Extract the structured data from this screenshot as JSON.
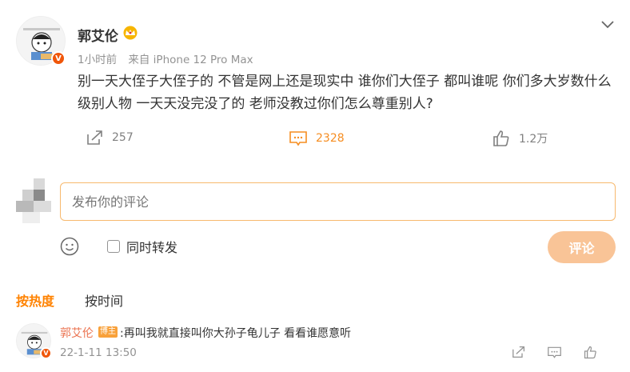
{
  "post": {
    "author": "郭艾伦",
    "time": "1小时前",
    "source": "来自 iPhone 12 Pro Max",
    "text": "别一天大侄子大侄子的 不管是网上还是现实中 谁你们大侄子 都叫谁呢 你们多大岁数什么级别人物 一天天没完没了的 老师没教过你们怎么尊重别人?",
    "shares": "257",
    "comments": "2328",
    "likes": "1.2万"
  },
  "composer": {
    "placeholder": "发布你的评论",
    "repost_label": "同时转发",
    "submit_label": "评论"
  },
  "sort": {
    "hot": "按热度",
    "time": "按时间"
  },
  "first_comment": {
    "author": "郭艾伦",
    "tag": "博主",
    "text": ":再叫我就直接叫你大孙子龟儿子 看看谁愿意听",
    "time": "22-1-11 13:50"
  },
  "colors": {
    "accent": "#ff8200",
    "verified_badge": "#f0560a",
    "comment_count": "#f68d21",
    "author_link": "#eb7350",
    "submit_disabled": "#f9c497"
  },
  "icons": {
    "share": "share-icon",
    "comment": "comment-icon",
    "like": "thumbs-up-icon",
    "emoji": "smiley-icon",
    "crown": "crown-icon",
    "more": "chevron-down-icon"
  }
}
